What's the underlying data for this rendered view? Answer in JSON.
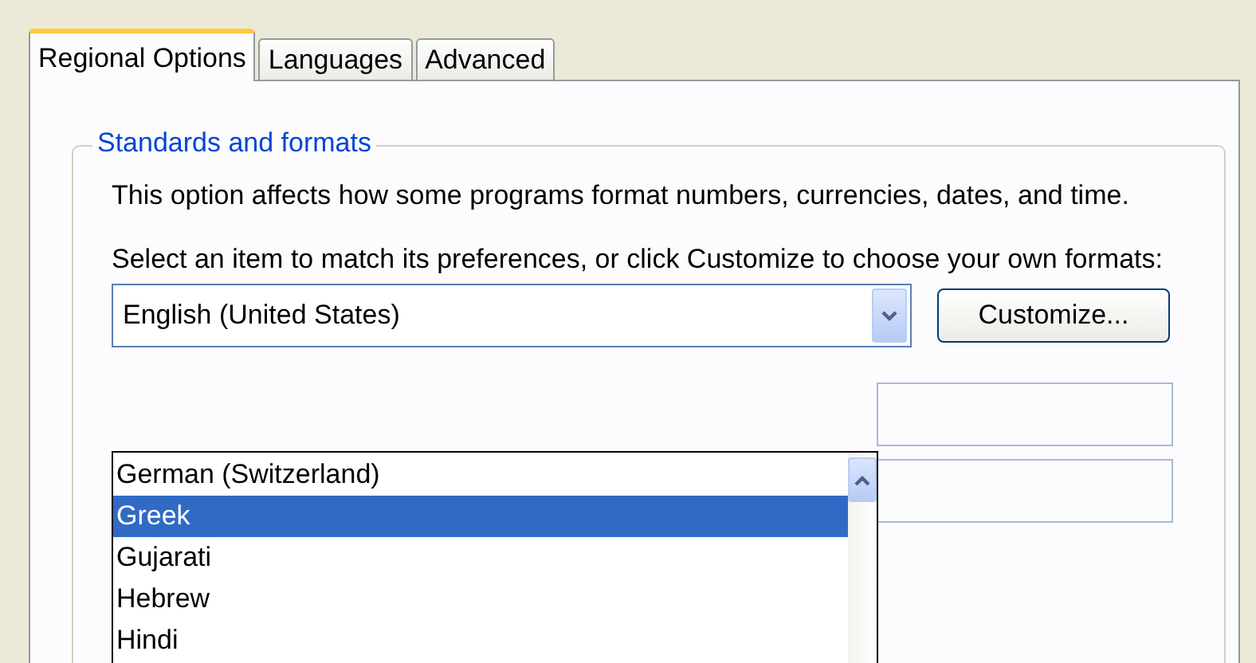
{
  "tabs": [
    {
      "label": "Regional Options",
      "selected": true
    },
    {
      "label": "Languages",
      "selected": false
    },
    {
      "label": "Advanced",
      "selected": false
    }
  ],
  "group": {
    "title": "Standards and formats",
    "description": "This option affects how some programs format numbers, currencies, dates, and time.",
    "instruction": "Select an item to match its preferences, or click Customize to choose your own formats:",
    "combo": {
      "value": "English (United States)",
      "expanded": true
    },
    "customize_button": "Customize...",
    "dropdown_items": [
      {
        "label": "German (Switzerland)",
        "selected": false
      },
      {
        "label": "Greek",
        "selected": true
      },
      {
        "label": "Gujarati",
        "selected": false
      },
      {
        "label": "Hebrew",
        "selected": false
      },
      {
        "label": "Hindi",
        "selected": false
      }
    ]
  }
}
